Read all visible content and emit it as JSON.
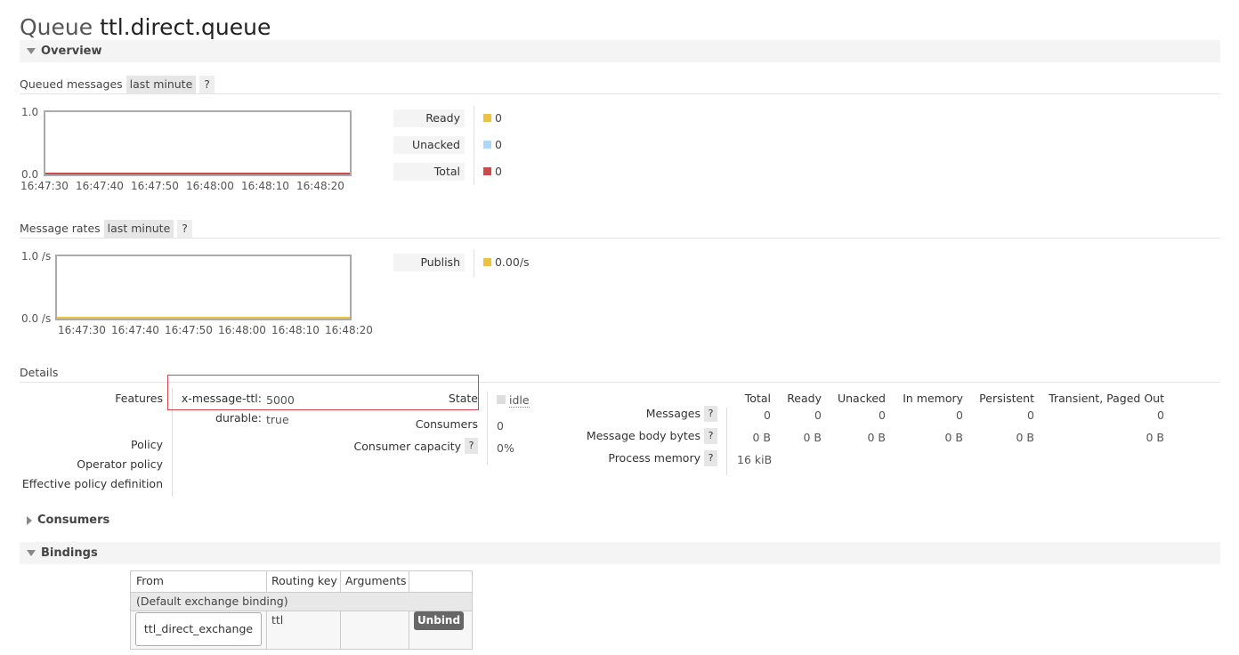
{
  "page": {
    "title_prefix": "Queue",
    "queue_name": "ttl.direct.queue"
  },
  "sections": {
    "overview": "Overview",
    "consumers": "Consumers",
    "bindings": "Bindings"
  },
  "queued_messages": {
    "label": "Queued messages",
    "range": "last minute",
    "help": "?",
    "chart": {
      "y_max": "1.0",
      "y_min": "0.0",
      "x_ticks": [
        "16:47:30",
        "16:47:40",
        "16:47:50",
        "16:48:00",
        "16:48:10",
        "16:48:20"
      ]
    },
    "legend": [
      {
        "name": "Ready",
        "value": "0",
        "color": "#edc240"
      },
      {
        "name": "Unacked",
        "value": "0",
        "color": "#afd8f8"
      },
      {
        "name": "Total",
        "value": "0",
        "color": "#cb4b4b"
      }
    ]
  },
  "message_rates": {
    "label": "Message rates",
    "range": "last minute",
    "help": "?",
    "chart": {
      "y_max": "1.0 /s",
      "y_min": "0.0 /s",
      "x_ticks": [
        "16:47:30",
        "16:47:40",
        "16:47:50",
        "16:48:00",
        "16:48:10",
        "16:48:20"
      ]
    },
    "legend": [
      {
        "name": "Publish",
        "value": "0.00/s",
        "color": "#edc240"
      }
    ]
  },
  "details": {
    "label": "Details",
    "features_label": "Features",
    "args": [
      {
        "key": "x-message-ttl:",
        "value": "5000"
      },
      {
        "key": "durable:",
        "value": "true"
      }
    ],
    "policy_label": "Policy",
    "operator_policy_label": "Operator policy",
    "effective_policy_label": "Effective policy definition",
    "state_label": "State",
    "state_value": "idle",
    "consumers_label": "Consumers",
    "consumers_value": "0",
    "consumer_capacity_label": "Consumer capacity",
    "consumer_capacity_help": "?",
    "consumer_capacity_value": "0%",
    "stats": {
      "columns": [
        "Total",
        "Ready",
        "Unacked",
        "In memory",
        "Persistent",
        "Transient, Paged Out"
      ],
      "rows": [
        {
          "label": "Messages",
          "help": "?",
          "values": [
            "0",
            "0",
            "0",
            "0",
            "0",
            "0"
          ]
        },
        {
          "label": "Message body bytes",
          "help": "?",
          "values": [
            "0 B",
            "0 B",
            "0 B",
            "0 B",
            "0 B",
            "0 B"
          ]
        },
        {
          "label": "Process memory",
          "help": "?",
          "values": [
            "16 kiB"
          ]
        }
      ]
    }
  },
  "bindings": {
    "headers": [
      "From",
      "Routing key",
      "Arguments",
      ""
    ],
    "default_binding": "(Default exchange binding)",
    "rows": [
      {
        "from": "ttl_direct_exchange",
        "routing_key": "ttl",
        "arguments": "",
        "action": "Unbind"
      }
    ]
  }
}
